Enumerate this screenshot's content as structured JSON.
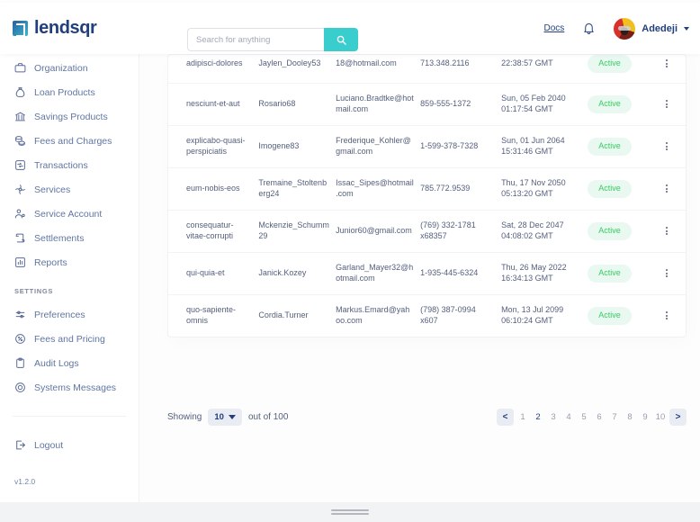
{
  "brand": {
    "name": "lendsqr",
    "accent": "#39cdcd",
    "navy": "#213f7d"
  },
  "header": {
    "search_placeholder": "Search for anything",
    "search_value": "",
    "search_icon": "search-icon",
    "docs_label": "Docs",
    "bell_icon": "notification-bell-icon",
    "user_name": "Adedeji",
    "caret_icon": "chevron-down-icon"
  },
  "sidebar": {
    "items": [
      {
        "label": "Organization",
        "icon": "briefcase-icon"
      },
      {
        "label": "Loan Products",
        "icon": "sack-icon"
      },
      {
        "label": "Savings Products",
        "icon": "bank-icon"
      },
      {
        "label": "Fees and Charges",
        "icon": "coins-icon"
      },
      {
        "label": "Transactions",
        "icon": "transactions-icon"
      },
      {
        "label": "Services",
        "icon": "galaxy-icon"
      },
      {
        "label": "Service Account",
        "icon": "user-cog-icon"
      },
      {
        "label": "Settlements",
        "icon": "scroll-icon"
      },
      {
        "label": "Reports",
        "icon": "chart-bar-icon"
      }
    ],
    "settings_label": "SETTINGS",
    "settings_items": [
      {
        "label": "Preferences",
        "icon": "sliders-icon"
      },
      {
        "label": "Fees and Pricing",
        "icon": "badge-percent-icon"
      },
      {
        "label": "Audit Logs",
        "icon": "clipboard-icon"
      },
      {
        "label": "Systems Messages",
        "icon": "tire-icon"
      }
    ],
    "logout_label": "Logout",
    "logout_icon": "sign-out-icon",
    "version": "v1.2.0"
  },
  "table": {
    "rows": [
      {
        "organization": "adipisci-dolores",
        "username": "Jaylen_Dooley53",
        "email": "18@hotmail.com",
        "phone": "713.348.2116",
        "date_joined": "22:38:57 GMT",
        "status": "Active"
      },
      {
        "organization": "nesciunt-et-aut",
        "username": "Rosario68",
        "email": "Luciano.Bradtke@hotmail.com",
        "phone": "859-555-1372",
        "date_joined": "Sun, 05 Feb 2040 01:17:54 GMT",
        "status": "Active"
      },
      {
        "organization": "explicabo-quasi-perspiciatis",
        "username": "Imogene83",
        "email": "Frederique_Kohler@gmail.com",
        "phone": "1-599-378-7328",
        "date_joined": "Sun, 01 Jun 2064 15:31:46 GMT",
        "status": "Active"
      },
      {
        "organization": "eum-nobis-eos",
        "username": "Tremaine_Stoltenberg24",
        "email": "Issac_Sipes@hotmail.com",
        "phone": "785.772.9539",
        "date_joined": "Thu, 17 Nov 2050 05:13:20 GMT",
        "status": "Active"
      },
      {
        "organization": "consequatur-vitae-corrupti",
        "username": "Mckenzie_Schumm29",
        "email": "Junior60@gmail.com",
        "phone": "(769) 332-1781 x68357",
        "date_joined": "Sat, 28 Dec 2047 04:08:02 GMT",
        "status": "Active"
      },
      {
        "organization": "qui-quia-et",
        "username": "Janick.Kozey",
        "email": "Garland_Mayer32@hotmail.com",
        "phone": "1-935-445-6324",
        "date_joined": "Thu, 26 May 2022 16:34:13 GMT",
        "status": "Active"
      },
      {
        "organization": "quo-sapiente-omnis",
        "username": "Cordia.Turner",
        "email": "Markus.Emard@yahoo.com",
        "phone": "(798) 387-0994 x607",
        "date_joined": "Mon, 13 Jul 2099 06:10:24 GMT",
        "status": "Active"
      }
    ],
    "row_action_icon": "more-vertical-icon",
    "status_color": "#39cd62",
    "status_bg": "#e9f8f0"
  },
  "pagination": {
    "showing_label": "Showing",
    "per_page": "10",
    "out_of_label": "out of 100",
    "prev_label": "<",
    "next_label": ">",
    "pages": [
      "1",
      "2",
      "3",
      "4",
      "5",
      "6",
      "7",
      "8",
      "9",
      "10"
    ],
    "active_page": "2"
  }
}
